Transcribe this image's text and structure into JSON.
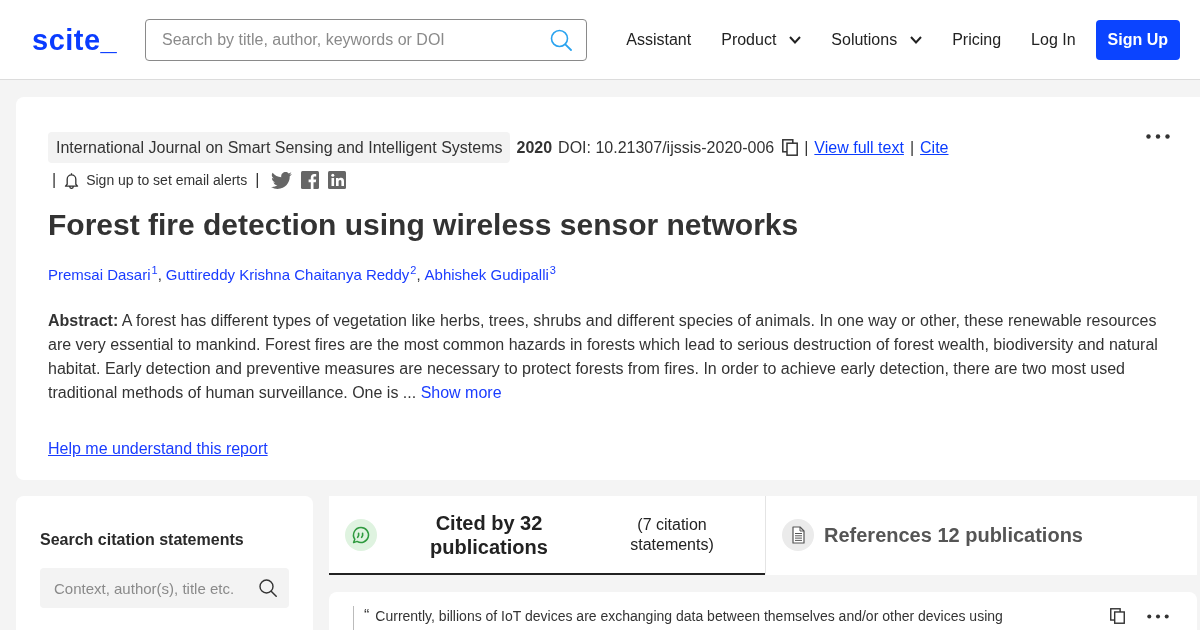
{
  "header": {
    "logo": "scite_",
    "search": {
      "placeholder": "Search by title, author, keywords or DOI"
    },
    "nav": [
      {
        "label": "Assistant",
        "kind": "link"
      },
      {
        "label": "Product",
        "kind": "dropdown"
      },
      {
        "label": "Solutions",
        "kind": "dropdown"
      },
      {
        "label": "Pricing",
        "kind": "link"
      },
      {
        "label": "Log In",
        "kind": "link"
      },
      {
        "label": "Sign Up",
        "kind": "button"
      }
    ]
  },
  "paper": {
    "meta_rows": [
      [
        {
          "kind": "chip",
          "text": "International Journal on Smart Sensing and Intelligent Systems"
        },
        {
          "kind": "strong",
          "text": "2020"
        },
        {
          "kind": "plain",
          "text": "DOI: 10.21307/ijssis-2020-006"
        },
        {
          "kind": "copy"
        },
        {
          "kind": "separator",
          "text": "|"
        },
        {
          "kind": "link",
          "text": "View full text"
        },
        {
          "kind": "separator",
          "text": "|"
        },
        {
          "kind": "link",
          "text": "Cite"
        }
      ],
      [
        {
          "kind": "separator",
          "text": "|"
        },
        {
          "kind": "alert",
          "text": "Sign up to set email alerts"
        },
        {
          "kind": "separator",
          "text": "|"
        },
        {
          "kind": "share"
        }
      ]
    ],
    "title": "Forest fire detection using wireless sensor networks",
    "authors": [
      {
        "name": "Premsai Dasari",
        "sup": "1",
        "separator": ","
      },
      {
        "name": "Guttireddy Krishna Chaitanya Reddy",
        "sup": "2",
        "separator": ","
      },
      {
        "name": "Abhishek Gudipalli",
        "sup": "3"
      }
    ],
    "abstract": "**Abstract:** A forest has different types of vegetation like herbs, trees, shrubs and different species of animals. In one way or other, these renewable resources are very essential to mankind. Forest fires are the most common hazards in forests which lead to serious destruction of forest wealth, biodiversity and natural habitat. Early detection and preventive measures are necessary to protect forests from fires. In order to achieve early detection, there are two most used traditional methods of human surveillance. One is ...",
    "show_more": "Show more",
    "help_link": "Help me understand this report"
  },
  "citation_search": {
    "heading": "Search citation statements",
    "placeholder": "Context, author(s), title etc."
  },
  "tabs": [
    {
      "kind": "citing",
      "label": "Cited by 32 publications",
      "sub": "(7 citation statements)",
      "selected": true
    },
    {
      "kind": "references",
      "label": "References 12 publications",
      "selected": false
    }
  ],
  "statements": [
    {
      "quote": "“",
      "text": "Currently, billions of IoT devices are exchanging data between themselves and/or other devices using"
    }
  ]
}
